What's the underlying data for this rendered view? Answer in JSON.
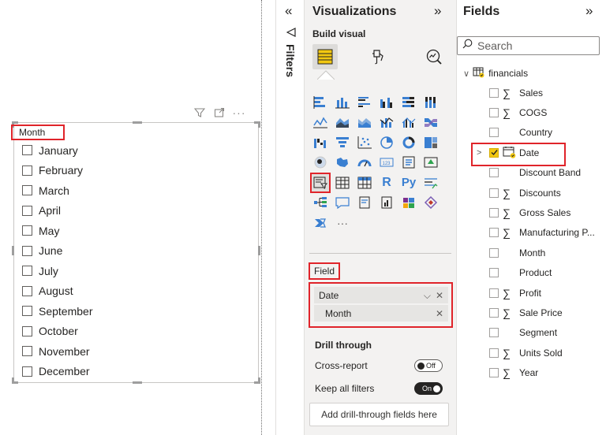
{
  "slicer": {
    "header": "Month",
    "items": [
      "January",
      "February",
      "March",
      "April",
      "May",
      "June",
      "July",
      "August",
      "September",
      "October",
      "November",
      "December"
    ]
  },
  "filters": {
    "label": "Filters"
  },
  "visualizations": {
    "title": "Visualizations",
    "build_visual_label": "Build visual",
    "field_well_label": "Field",
    "field_well": {
      "date": "Date",
      "month": "Month"
    },
    "drill_through": {
      "title": "Drill through",
      "cross_report": {
        "label": "Cross-report",
        "state": "Off"
      },
      "keep_all_filters": {
        "label": "Keep all filters",
        "state": "On"
      },
      "drop_label": "Add drill-through fields here"
    },
    "more_label": "···",
    "icons": [
      "stacked-bar",
      "stacked-column",
      "clustered-bar",
      "clustered-column",
      "100-stacked-bar",
      "100-stacked-column",
      "line",
      "area",
      "stacked-area",
      "line-stacked-column",
      "line-clustered-column",
      "ribbon",
      "waterfall",
      "funnel",
      "scatter",
      "pie",
      "donut",
      "treemap",
      "map",
      "filled-map",
      "gauge",
      "card",
      "multi-row-card",
      "kpi",
      "slicer",
      "table",
      "matrix",
      "r-visual",
      "python-visual",
      "key-influencers",
      "decomposition-tree",
      "qa",
      "narrative",
      "paginated-report",
      "power-apps",
      "power-automate",
      "get-more-visuals"
    ]
  },
  "fields": {
    "title": "Fields",
    "search_placeholder": "Search",
    "table_name": "financials",
    "items": [
      {
        "name": "Sales",
        "sigma": true,
        "checked": false
      },
      {
        "name": "COGS",
        "sigma": true,
        "checked": false
      },
      {
        "name": "Country",
        "sigma": false,
        "checked": false
      },
      {
        "name": "Date",
        "sigma": false,
        "checked": true,
        "hierarchy": true
      },
      {
        "name": "Discount Band",
        "sigma": false,
        "checked": false
      },
      {
        "name": "Discounts",
        "sigma": true,
        "checked": false
      },
      {
        "name": "Gross Sales",
        "sigma": true,
        "checked": false
      },
      {
        "name": "Manufacturing P...",
        "sigma": true,
        "checked": false
      },
      {
        "name": "Month",
        "sigma": false,
        "checked": false
      },
      {
        "name": "Product",
        "sigma": false,
        "checked": false
      },
      {
        "name": "Profit",
        "sigma": true,
        "checked": false
      },
      {
        "name": "Sale Price",
        "sigma": true,
        "checked": false
      },
      {
        "name": "Segment",
        "sigma": false,
        "checked": false
      },
      {
        "name": "Units Sold",
        "sigma": true,
        "checked": false
      },
      {
        "name": "Year",
        "sigma": true,
        "checked": false
      }
    ]
  },
  "colors": {
    "highlight": "#e0242a",
    "accent": "#f2c811",
    "pane_bg": "#f3f2f1",
    "icon_blue": "#3a7fd1"
  }
}
